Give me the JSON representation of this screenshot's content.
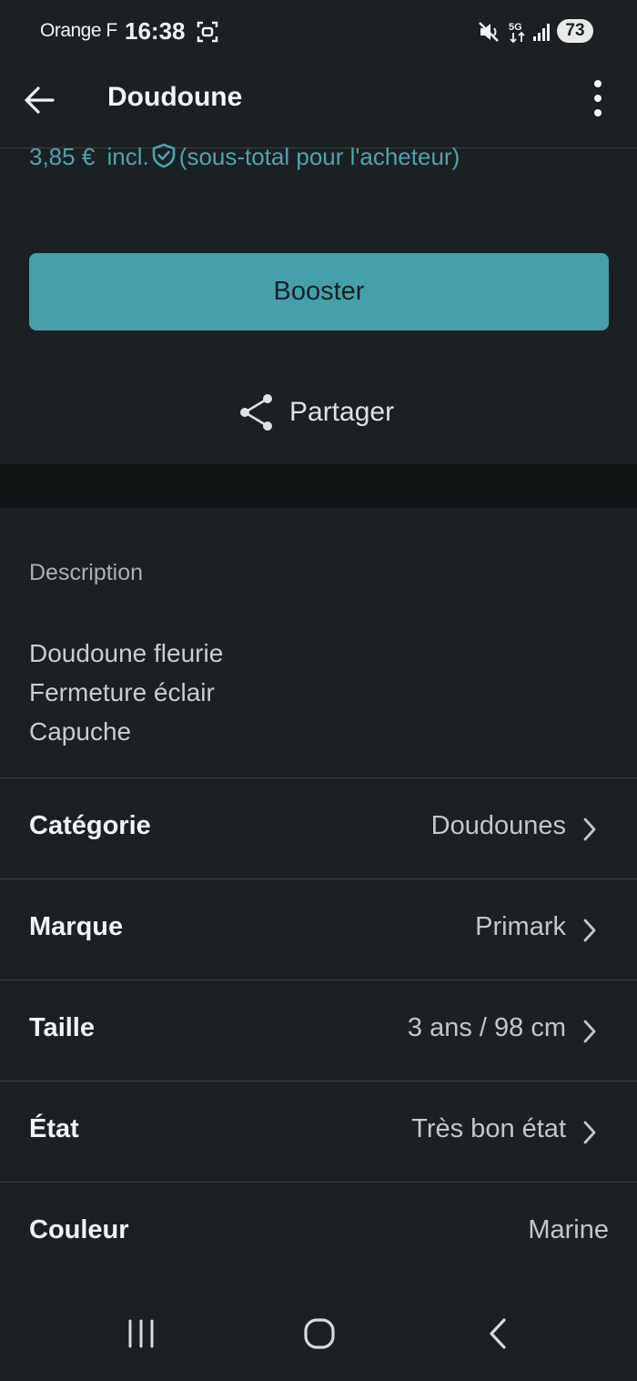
{
  "status_bar": {
    "carrier": "Orange F",
    "time": "16:38",
    "battery": "73",
    "icons": [
      "screenshot-icon",
      "mute-icon",
      "5g-icon",
      "signal-icon",
      "battery-icon"
    ]
  },
  "app_bar": {
    "title": "Doudoune",
    "back_icon": "arrow-left-icon",
    "more_icon": "more-vertical-icon"
  },
  "price": {
    "amount": "3,85 €",
    "incl": "incl.",
    "note": "(sous-total pour l'acheteur)",
    "icon": "shield-check-icon"
  },
  "actions": {
    "booster_label": "Booster",
    "share_label": "Partager",
    "share_icon": "share-icon"
  },
  "description": {
    "title": "Description",
    "lines": [
      "Doudoune fleurie",
      "Fermeture éclair",
      "Capuche"
    ]
  },
  "details": [
    {
      "label": "Catégorie",
      "value": "Doudounes",
      "has_chevron": true
    },
    {
      "label": "Marque",
      "value": "Primark",
      "has_chevron": true
    },
    {
      "label": "Taille",
      "value": "3 ans / 98 cm",
      "has_chevron": true
    },
    {
      "label": "État",
      "value": "Très bon état",
      "has_chevron": true
    },
    {
      "label": "Couleur",
      "value": "Marine",
      "has_chevron": false
    }
  ],
  "colors": {
    "background": "#1b2022",
    "accent": "#45a0ab",
    "price_text": "#4fa3ae"
  },
  "nav_bar": {
    "icons": [
      "recent-apps-icon",
      "home-icon",
      "back-nav-icon"
    ]
  }
}
